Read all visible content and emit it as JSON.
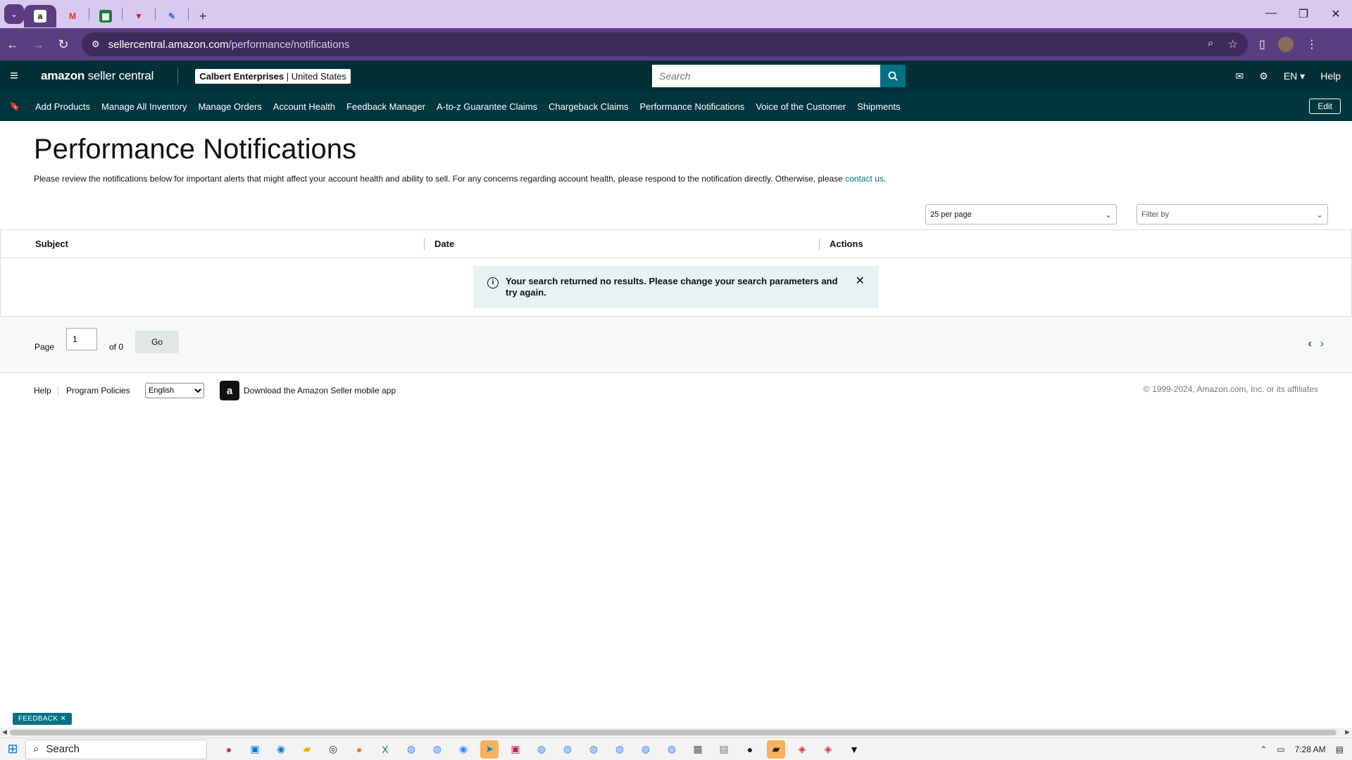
{
  "browser": {
    "tabs": [
      {
        "icon": "amazon-icon",
        "glyph": "a",
        "active": true
      },
      {
        "icon": "gmail-icon",
        "glyph": "M"
      },
      {
        "icon": "sheets-icon",
        "glyph": "▦"
      },
      {
        "icon": "tab-app-icon",
        "glyph": "▼"
      },
      {
        "icon": "tab-app-icon-2",
        "glyph": "✎"
      }
    ],
    "new_tab": "+",
    "url_domain": "sellercentral.amazon.com",
    "url_path": "/performance/notifications"
  },
  "header": {
    "logo_main": "amazon",
    "logo_sub": "seller central",
    "account_name": "Calbert Enterprises",
    "account_region": "United States",
    "search_placeholder": "Search",
    "language": "EN",
    "help": "Help"
  },
  "nav": {
    "items": [
      "Add Products",
      "Manage All Inventory",
      "Manage Orders",
      "Account Health",
      "Feedback Manager",
      "A-to-z Guarantee Claims",
      "Chargeback Claims",
      "Performance Notifications",
      "Voice of the Customer",
      "Shipments"
    ],
    "edit": "Edit"
  },
  "page": {
    "title": "Performance Notifications",
    "description": "Please review the notifications below for important alerts that might affect your account health and ability to sell. For any concerns regarding account health, please respond to the notification directly. Otherwise, please ",
    "contact_link": "contact us",
    "description_end": "."
  },
  "controls": {
    "per_page": "25 per page",
    "filter_placeholder": "Filter by"
  },
  "table": {
    "columns": [
      "Subject",
      "Date",
      "Actions"
    ],
    "empty_message": "Your search returned no results. Please change your search parameters and try again."
  },
  "pager": {
    "page_label": "Page",
    "current_page": "1",
    "of_label": "of 0",
    "go_label": "Go"
  },
  "footer": {
    "help": "Help",
    "program_policies": "Program Policies",
    "language_selected": "English",
    "app_text": "Download the Amazon Seller mobile app",
    "copyright": "© 1999-2024, Amazon.com, Inc. or its affiliates"
  },
  "feedback_tab": "FEEDBACK",
  "taskbar": {
    "search_label": "Search",
    "time": "7:28 AM"
  },
  "colors": {
    "header_bg": "#002f36",
    "nav_bg": "#00363d",
    "accent": "#007185",
    "alert_bg": "#e6f2f3",
    "browser_chrome": "#5a3e80"
  }
}
